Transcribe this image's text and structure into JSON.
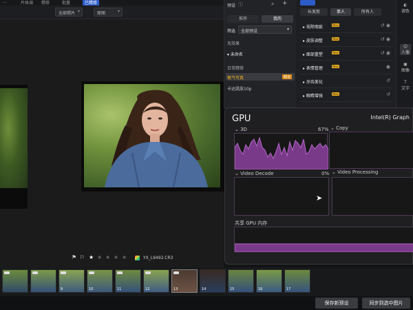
{
  "topmenu": {
    "items": [
      "...",
      "片体调",
      "精修",
      "批量",
      "已精修"
    ]
  },
  "toolbar": {
    "dropdown1": "全部照片",
    "dropdown2": "原图"
  },
  "viewer": {
    "filename": "YX_L9492.CR3"
  },
  "filmstrip": {
    "numbers": [
      "",
      "",
      "9",
      "10",
      "11",
      "12",
      "13",
      "14",
      "15",
      "16",
      "17"
    ]
  },
  "buttons": {
    "save_preset": "保存新预设",
    "sync": "同步到选中图片"
  },
  "presets": {
    "header": "预设",
    "tab_recommend": "推荐",
    "tab_mine": "我的",
    "filter_label": "筛选",
    "filter_value": "全部预设",
    "no_effect": "无效果",
    "unnamed": "未命名",
    "daily": "日常精修",
    "oxygen": "氧气写真",
    "oxygen_badge": "组合",
    "kadaa": "卡达肌肤10p"
  },
  "adjust": {
    "tab1": "长发剪",
    "tab2": "单人",
    "tab3": "所有人",
    "new_badge": "New",
    "sections": [
      "祛除瑕疵",
      "皮肤调整",
      "面部重塑",
      "表情管理",
      "牙齿美化",
      "眼睛增强"
    ]
  },
  "iconstrip": {
    "items": [
      "调色",
      "人像",
      "图像",
      "文字"
    ]
  },
  "gpu": {
    "title": "GPU",
    "name": "Intel(R) Graph",
    "label_3d": "3D",
    "pct_3d": "67%",
    "label_copy": "Copy",
    "label_decode": "Video Decode",
    "pct_decode": "0%",
    "label_processing": "Video Processing",
    "label_memory": "共享 GPU 内存"
  }
}
